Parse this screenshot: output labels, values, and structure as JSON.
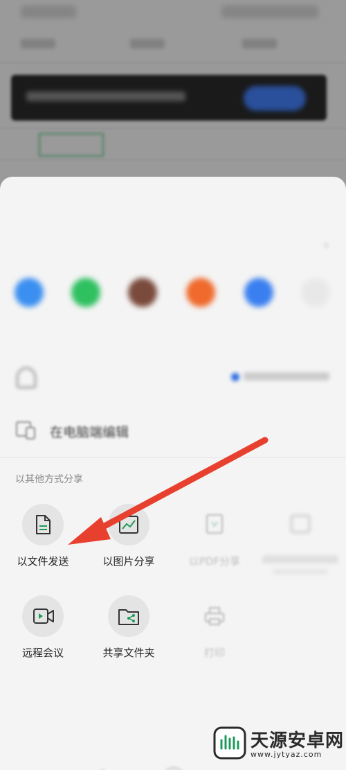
{
  "sheet": {
    "other_share_label": "以其他方式分享",
    "pc_edit_label": "在电脑端编辑"
  },
  "share_options_row1": [
    {
      "label": "以文件发送",
      "icon": "document-icon",
      "enabled": true
    },
    {
      "label": "以图片分享",
      "icon": "image-chart-icon",
      "enabled": true
    },
    {
      "label": "以PDF分享",
      "icon": "pdf-icon",
      "enabled": false
    },
    {
      "label": "",
      "icon": "more-icon",
      "enabled": false
    }
  ],
  "share_options_row2": [
    {
      "label": "远程会议",
      "icon": "video-icon",
      "enabled": true
    },
    {
      "label": "共享文件夹",
      "icon": "shared-folder-icon",
      "enabled": true
    },
    {
      "label": "打印",
      "icon": "printer-icon",
      "enabled": false
    }
  ],
  "watermark": {
    "text": "天源安卓网",
    "url": "www.jytyaz.com"
  },
  "colors": {
    "accent": "#1d9a5a",
    "arrow": "#e8402f",
    "toast_button": "#2a4f9b"
  }
}
